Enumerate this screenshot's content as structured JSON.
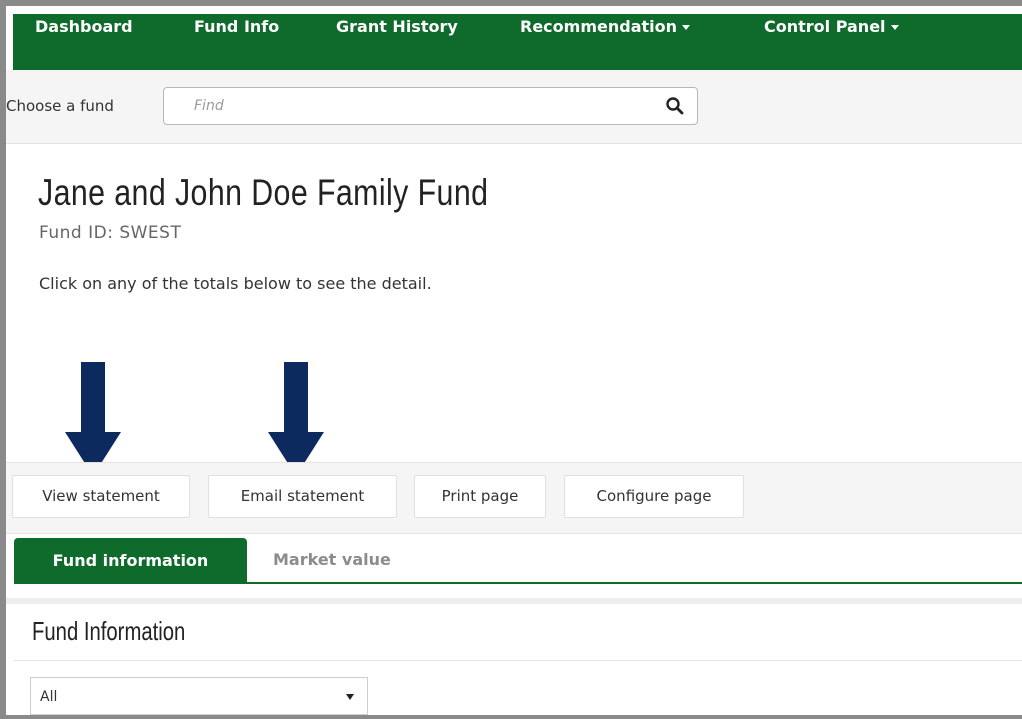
{
  "nav": {
    "dashboard": "Dashboard",
    "fund_info": "Fund Info",
    "grant_history": "Grant History",
    "recommendation": "Recommendation",
    "control_panel": "Control Panel"
  },
  "fund_selector": {
    "label": "Choose a fund",
    "placeholder": "Find",
    "icon": "search-icon"
  },
  "fund": {
    "title": "Jane and John Doe Family Fund",
    "id_text": "Fund ID: SWEST",
    "instruction": "Click on any of the totals below to see the detail."
  },
  "annotations": {
    "arrow_color": "#0d2a5e",
    "arrow_icon": "down-arrow-icon"
  },
  "actions": {
    "view_statement": "View statement",
    "email_statement": "Email statement",
    "print_page": "Print page",
    "configure_page": "Configure page"
  },
  "tabs": {
    "fund_information": "Fund information",
    "market_value": "Market value"
  },
  "section": {
    "title": "Fund Information",
    "filter_value": "All"
  },
  "colors": {
    "brand_green": "#0f6b2b",
    "tab_inactive": "#8c8c8c"
  }
}
